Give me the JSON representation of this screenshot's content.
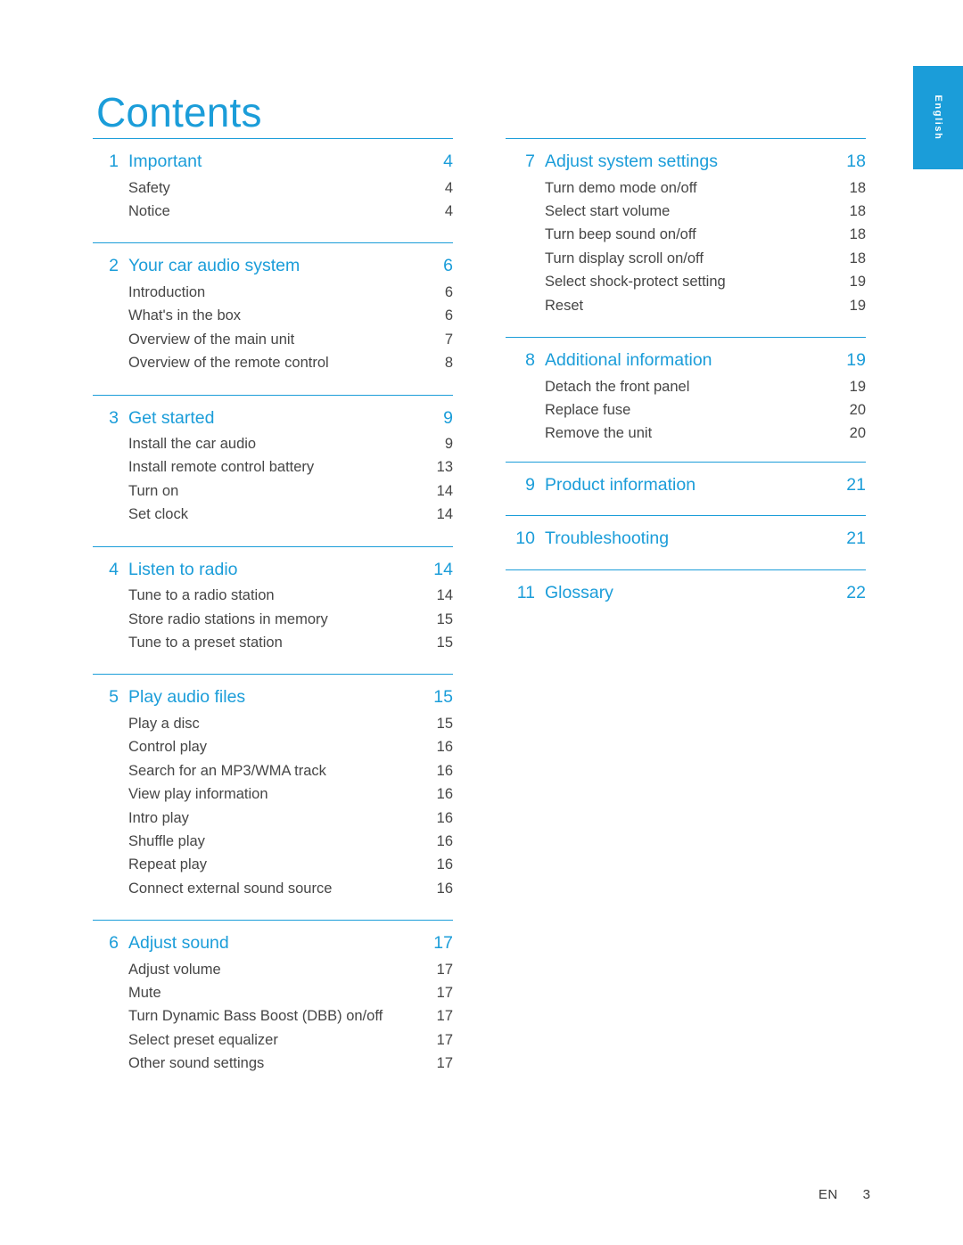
{
  "page": {
    "title": "Contents",
    "side_tab_label": "English",
    "footer_lang": "EN",
    "footer_page": "3",
    "accent_color": "#1b9dd9",
    "text_color": "#464646"
  },
  "left_column": [
    {
      "number": "1",
      "title": "Important",
      "page": "4",
      "entries": [
        {
          "title": "Safety",
          "page": "4"
        },
        {
          "title": "Notice",
          "page": "4"
        }
      ]
    },
    {
      "number": "2",
      "title": "Your car audio system",
      "page": "6",
      "entries": [
        {
          "title": "Introduction",
          "page": "6"
        },
        {
          "title": "What's in the box",
          "page": "6"
        },
        {
          "title": "Overview of the main unit",
          "page": "7"
        },
        {
          "title": "Overview of the remote control",
          "page": "8"
        }
      ]
    },
    {
      "number": "3",
      "title": "Get started",
      "page": "9",
      "entries": [
        {
          "title": "Install the car audio",
          "page": "9"
        },
        {
          "title": "Install remote control battery",
          "page": "13"
        },
        {
          "title": "Turn on",
          "page": "14"
        },
        {
          "title": "Set clock",
          "page": "14"
        }
      ]
    },
    {
      "number": "4",
      "title": "Listen to radio",
      "page": "14",
      "entries": [
        {
          "title": "Tune to a radio station",
          "page": "14"
        },
        {
          "title": "Store radio stations in memory",
          "page": "15"
        },
        {
          "title": "Tune to a preset station",
          "page": "15"
        }
      ]
    },
    {
      "number": "5",
      "title": "Play audio files",
      "page": "15",
      "entries": [
        {
          "title": "Play a disc",
          "page": "15"
        },
        {
          "title": "Control play",
          "page": "16"
        },
        {
          "title": "Search for an MP3/WMA track",
          "page": "16"
        },
        {
          "title": "View play information",
          "page": "16"
        },
        {
          "title": "Intro play",
          "page": "16"
        },
        {
          "title": "Shuffle play",
          "page": "16"
        },
        {
          "title": "Repeat play",
          "page": "16"
        },
        {
          "title": "Connect external sound source",
          "page": "16"
        }
      ]
    },
    {
      "number": "6",
      "title": "Adjust sound",
      "page": "17",
      "entries": [
        {
          "title": "Adjust volume",
          "page": "17"
        },
        {
          "title": "Mute",
          "page": "17"
        },
        {
          "title": "Turn Dynamic Bass Boost (DBB) on/off",
          "page": "17"
        },
        {
          "title": "Select preset equalizer",
          "page": "17"
        },
        {
          "title": "Other sound settings",
          "page": "17"
        }
      ]
    }
  ],
  "right_column": [
    {
      "number": "7",
      "title": "Adjust system settings",
      "page": "18",
      "entries": [
        {
          "title": "Turn demo mode on/off",
          "page": "18"
        },
        {
          "title": "Select start volume",
          "page": "18"
        },
        {
          "title": "Turn beep sound on/off",
          "page": "18"
        },
        {
          "title": "Turn display scroll on/off",
          "page": "18"
        },
        {
          "title": "Select shock-protect setting",
          "page": "19"
        },
        {
          "title": "Reset",
          "page": "19"
        }
      ]
    },
    {
      "number": "8",
      "title": "Additional information",
      "page": "19",
      "entries": [
        {
          "title": "Detach the front panel",
          "page": "19"
        },
        {
          "title": "Replace fuse",
          "page": "20"
        },
        {
          "title": "Remove the unit",
          "page": "20"
        }
      ]
    },
    {
      "number": "9",
      "title": "Product information",
      "page": "21",
      "entries": []
    },
    {
      "number": "10",
      "title": "Troubleshooting",
      "page": "21",
      "entries": []
    },
    {
      "number": "11",
      "title": "Glossary",
      "page": "22",
      "entries": []
    }
  ]
}
